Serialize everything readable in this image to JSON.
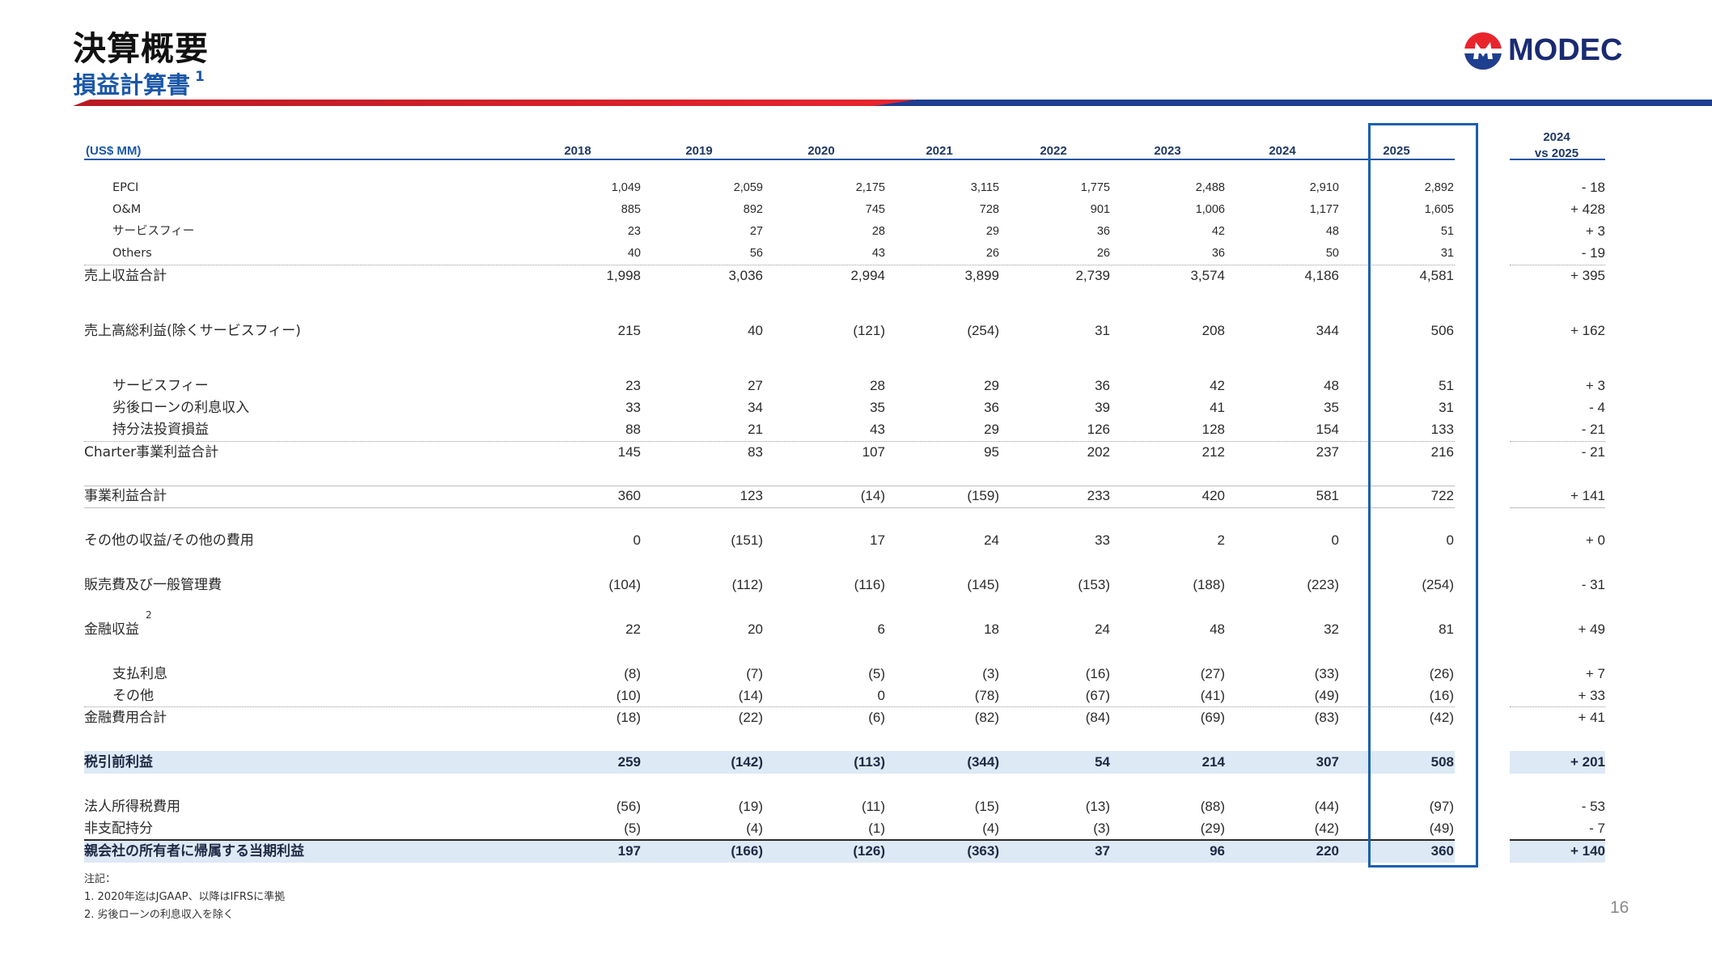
{
  "header": {
    "title": "決算概要",
    "subtitle": "損益計算書",
    "subtitle_note": "1",
    "logo_text": "MODEC",
    "logo_icon": "modec-logo-icon"
  },
  "table": {
    "unit_label": "(US$ MM)",
    "years": [
      "2018",
      "2019",
      "2020",
      "2021",
      "2022",
      "2023",
      "2024",
      "2025"
    ],
    "compare_header_line1": "2024",
    "compare_header_line2": "vs 2025",
    "rows": [
      {
        "label": "EPCI",
        "values": [
          "1,049",
          "2,059",
          "2,175",
          "3,115",
          "1,775",
          "2,488",
          "2,910",
          "2,892"
        ],
        "change": "- 18"
      },
      {
        "label": "O&M",
        "values": [
          "885",
          "892",
          "745",
          "728",
          "901",
          "1,006",
          "1,177",
          "1,605"
        ],
        "change": "+ 428"
      },
      {
        "label": "サービスフィー",
        "values": [
          "23",
          "27",
          "28",
          "29",
          "36",
          "42",
          "48",
          "51"
        ],
        "change": "+ 3"
      },
      {
        "label": "Others",
        "values": [
          "40",
          "56",
          "43",
          "26",
          "26",
          "36",
          "50",
          "31"
        ],
        "change": "- 19"
      },
      {
        "label": "売上収益合計",
        "values": [
          "1,998",
          "3,036",
          "2,994",
          "3,899",
          "2,739",
          "3,574",
          "4,186",
          "4,581"
        ],
        "change": "+ 395"
      },
      {
        "label": "売上高総利益(除くサービスフィー)",
        "values": [
          "215",
          "40",
          "(121)",
          "(254)",
          "31",
          "208",
          "344",
          "506"
        ],
        "change": "+ 162"
      },
      {
        "label": "サービスフィー",
        "values": [
          "23",
          "27",
          "28",
          "29",
          "36",
          "42",
          "48",
          "51"
        ],
        "change": "+ 3"
      },
      {
        "label": "劣後ローンの利息収入",
        "values": [
          "33",
          "34",
          "35",
          "36",
          "39",
          "41",
          "35",
          "31"
        ],
        "change": "- 4"
      },
      {
        "label": "持分法投資損益",
        "values": [
          "88",
          "21",
          "43",
          "29",
          "126",
          "128",
          "154",
          "133"
        ],
        "change": "- 21"
      },
      {
        "label": "Charter事業利益合計",
        "values": [
          "145",
          "83",
          "107",
          "95",
          "202",
          "212",
          "237",
          "216"
        ],
        "change": "- 21"
      },
      {
        "label": "事業利益合計",
        "values": [
          "360",
          "123",
          "(14)",
          "(159)",
          "233",
          "420",
          "581",
          "722"
        ],
        "change": "+ 141"
      },
      {
        "label": "その他の収益/その他の費用",
        "values": [
          "0",
          "(151)",
          "17",
          "24",
          "33",
          "2",
          "0",
          "0"
        ],
        "change": "+ 0"
      },
      {
        "label": "販売費及び一般管理費",
        "values": [
          "(104)",
          "(112)",
          "(116)",
          "(145)",
          "(153)",
          "(188)",
          "(223)",
          "(254)"
        ],
        "change": "- 31"
      },
      {
        "label": "金融収益",
        "note": "2",
        "values": [
          "22",
          "20",
          "6",
          "18",
          "24",
          "48",
          "32",
          "81"
        ],
        "change": "+ 49"
      },
      {
        "label": "支払利息",
        "values": [
          "(8)",
          "(7)",
          "(5)",
          "(3)",
          "(16)",
          "(27)",
          "(33)",
          "(26)"
        ],
        "change": "+ 7"
      },
      {
        "label": "その他",
        "values": [
          "(10)",
          "(14)",
          "0",
          "(78)",
          "(67)",
          "(41)",
          "(49)",
          "(16)"
        ],
        "change": "+ 33"
      },
      {
        "label": "金融費用合計",
        "values": [
          "(18)",
          "(22)",
          "(6)",
          "(82)",
          "(84)",
          "(69)",
          "(83)",
          "(42)"
        ],
        "change": "+ 41"
      },
      {
        "label": "税引前利益",
        "values": [
          "259",
          "(142)",
          "(113)",
          "(344)",
          "54",
          "214",
          "307",
          "508"
        ],
        "change": "+ 201"
      },
      {
        "label": "法人所得税費用",
        "values": [
          "(56)",
          "(19)",
          "(11)",
          "(15)",
          "(13)",
          "(88)",
          "(44)",
          "(97)"
        ],
        "change": "- 53"
      },
      {
        "label": "非支配持分",
        "values": [
          "(5)",
          "(4)",
          "(1)",
          "(4)",
          "(3)",
          "(29)",
          "(42)",
          "(49)"
        ],
        "change": "- 7"
      },
      {
        "label": "親会社の所有者に帰属する当期利益",
        "values": [
          "197",
          "(166)",
          "(126)",
          "(363)",
          "37",
          "96",
          "220",
          "360"
        ],
        "change": "+ 140"
      }
    ]
  },
  "notes": {
    "heading": "注記：",
    "note1": "1. 2020年迄はJGAAP、以降はIFRSに準拠",
    "note2": "2. 劣後ローンの利息収入を除く"
  },
  "page_number": "16",
  "colors": {
    "accent_blue": "#1b57a8",
    "brand_red": "#e8252d",
    "brand_navy": "#1e3f8f",
    "highlight": "#dde9f5"
  }
}
